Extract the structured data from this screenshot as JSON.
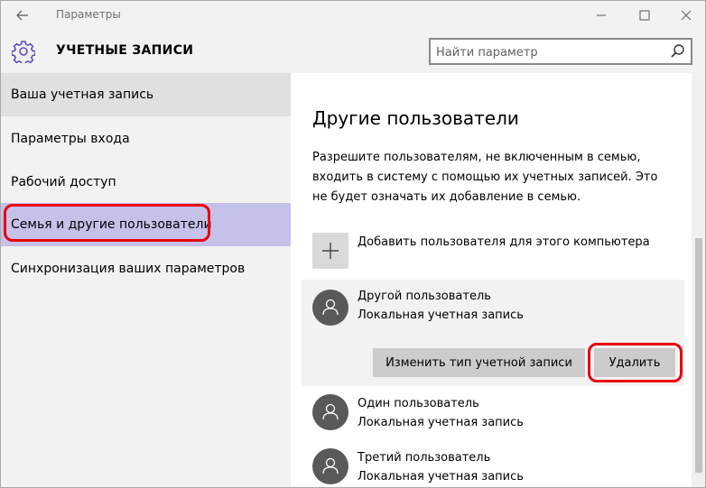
{
  "window": {
    "title": "Параметры"
  },
  "header": {
    "section_title": "УЧЕТНЫЕ ЗАПИСИ",
    "search_placeholder": "Найти параметр"
  },
  "sidebar": {
    "items": [
      {
        "label": "Ваша учетная запись"
      },
      {
        "label": "Параметры входа"
      },
      {
        "label": "Рабочий доступ"
      },
      {
        "label": "Семья и другие пользователи"
      },
      {
        "label": "Синхронизация ваших параметров"
      }
    ]
  },
  "content": {
    "title": "Другие пользователи",
    "description": "Разрешите пользователям, не включенным в семью, входить в систему с помощью их учетных записей. Это не будет означать их добавление в семью.",
    "add_user_label": "Добавить пользователя для этого компьютера",
    "users": [
      {
        "name": "Другой пользователь",
        "type": "Локальная учетная запись"
      },
      {
        "name": "Один пользователь",
        "type": "Локальная учетная запись"
      },
      {
        "name": "Третий пользователь",
        "type": "Локальная учетная запись"
      }
    ],
    "change_type_button": "Изменить тип учетной записи",
    "delete_button": "Удалить"
  },
  "colors": {
    "selected_nav": "#c4c2e9",
    "highlight": "#e8000f",
    "accent": "#5b4fbe"
  }
}
